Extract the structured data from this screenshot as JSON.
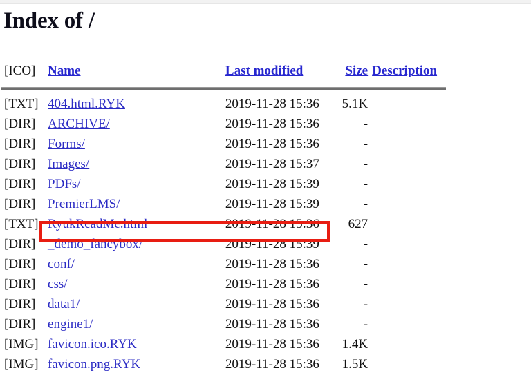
{
  "page": {
    "title": "Index of /",
    "accent_link_color": "#2b2bc4",
    "highlight_color": "#e81d12",
    "rule_color": "#6e6e6e"
  },
  "table": {
    "headers": {
      "icon": "[ICO]",
      "name": "Name",
      "last_modified": "Last modified",
      "size": "Size",
      "description": "Description"
    },
    "rows": [
      {
        "icon": "[TXT]",
        "name": "404.html.RYK",
        "last_modified": "2019-11-28 15:36",
        "size": "5.1K",
        "description": ""
      },
      {
        "icon": "[DIR]",
        "name": "ARCHIVE/",
        "last_modified": "2019-11-28 15:36",
        "size": "-",
        "description": ""
      },
      {
        "icon": "[DIR]",
        "name": "Forms/",
        "last_modified": "2019-11-28 15:36",
        "size": "-",
        "description": ""
      },
      {
        "icon": "[DIR]",
        "name": "Images/",
        "last_modified": "2019-11-28 15:37",
        "size": "-",
        "description": ""
      },
      {
        "icon": "[DIR]",
        "name": "PDFs/",
        "last_modified": "2019-11-28 15:39",
        "size": "-",
        "description": ""
      },
      {
        "icon": "[DIR]",
        "name": "PremierLMS/",
        "last_modified": "2019-11-28 15:39",
        "size": "-",
        "description": ""
      },
      {
        "icon": "[TXT]",
        "name": "RyukReadMe.html",
        "last_modified": "2019-11-28 15:36",
        "size": "627",
        "description": ""
      },
      {
        "icon": "[DIR]",
        "name": "_demo_fancybox/",
        "last_modified": "2019-11-28 15:39",
        "size": "-",
        "description": ""
      },
      {
        "icon": "[DIR]",
        "name": "conf/",
        "last_modified": "2019-11-28 15:36",
        "size": "-",
        "description": ""
      },
      {
        "icon": "[DIR]",
        "name": "css/",
        "last_modified": "2019-11-28 15:36",
        "size": "-",
        "description": ""
      },
      {
        "icon": "[DIR]",
        "name": "data1/",
        "last_modified": "2019-11-28 15:36",
        "size": "-",
        "description": ""
      },
      {
        "icon": "[DIR]",
        "name": "engine1/",
        "last_modified": "2019-11-28 15:36",
        "size": "-",
        "description": ""
      },
      {
        "icon": "[IMG]",
        "name": "favicon.ico.RYK",
        "last_modified": "2019-11-28 15:36",
        "size": "1.4K",
        "description": ""
      },
      {
        "icon": "[IMG]",
        "name": "favicon.png.RYK",
        "last_modified": "2019-11-28 15:36",
        "size": "1.5K",
        "description": ""
      }
    ],
    "highlighted_row_index": 6
  }
}
